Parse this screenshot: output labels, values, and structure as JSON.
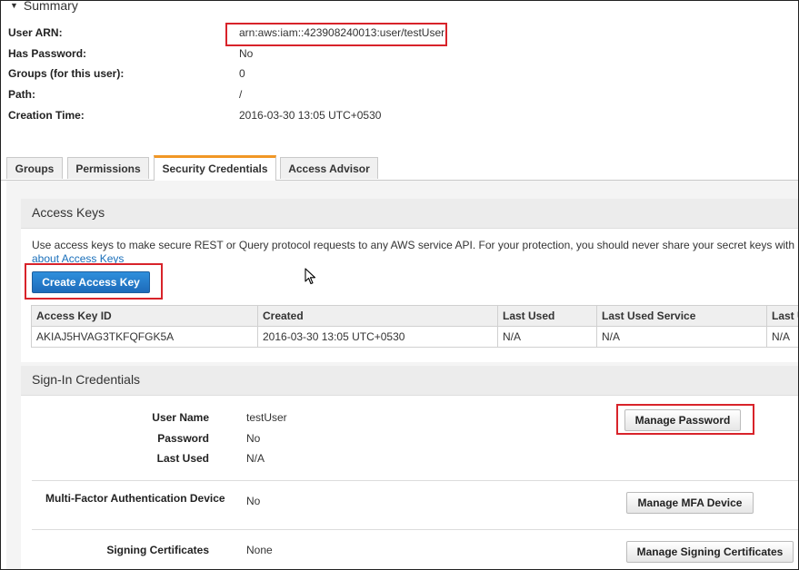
{
  "summary": {
    "title": "Summary",
    "rows": [
      {
        "label": "User ARN:",
        "value": "arn:aws:iam::423908240013:user/testUser"
      },
      {
        "label": "Has Password:",
        "value": "No"
      },
      {
        "label": "Groups (for this user):",
        "value": "0"
      },
      {
        "label": "Path:",
        "value": "/"
      },
      {
        "label": "Creation Time:",
        "value": "2016-03-30 13:05 UTC+0530"
      }
    ]
  },
  "tabs": [
    "Groups",
    "Permissions",
    "Security Credentials",
    "Access Advisor"
  ],
  "active_tab": "Security Credentials",
  "access_keys": {
    "title": "Access Keys",
    "description": "Use access keys to make secure REST or Query protocol requests to any AWS service API. For your protection, you should never share your secret keys with anyone.",
    "link": "about Access Keys",
    "create_button": "Create Access Key",
    "columns": [
      "Access Key ID",
      "Created",
      "Last Used",
      "Last Used Service",
      "Last U"
    ],
    "rows": [
      [
        "AKIAJ5HVAG3TKFQFGK5A",
        "2016-03-30 13:05 UTC+0530",
        "N/A",
        "N/A",
        "N/A"
      ]
    ]
  },
  "signin": {
    "title": "Sign-In Credentials",
    "user_name_label": "User Name",
    "user_name": "testUser",
    "password_label": "Password",
    "password": "No",
    "last_used_label": "Last Used",
    "last_used": "N/A",
    "manage_password_button": "Manage Password",
    "mfa_label": "Multi-Factor Authentication Device",
    "mfa_value": "No",
    "manage_mfa_button": "Manage MFA Device",
    "signing_label": "Signing Certificates",
    "signing_value": "None",
    "manage_signing_button": "Manage Signing Certificates"
  },
  "colors": {
    "highlight": "#d8232a",
    "active_tab_accent": "#f19725",
    "primary_button": "#1d6bba",
    "link": "#1a6fba"
  }
}
